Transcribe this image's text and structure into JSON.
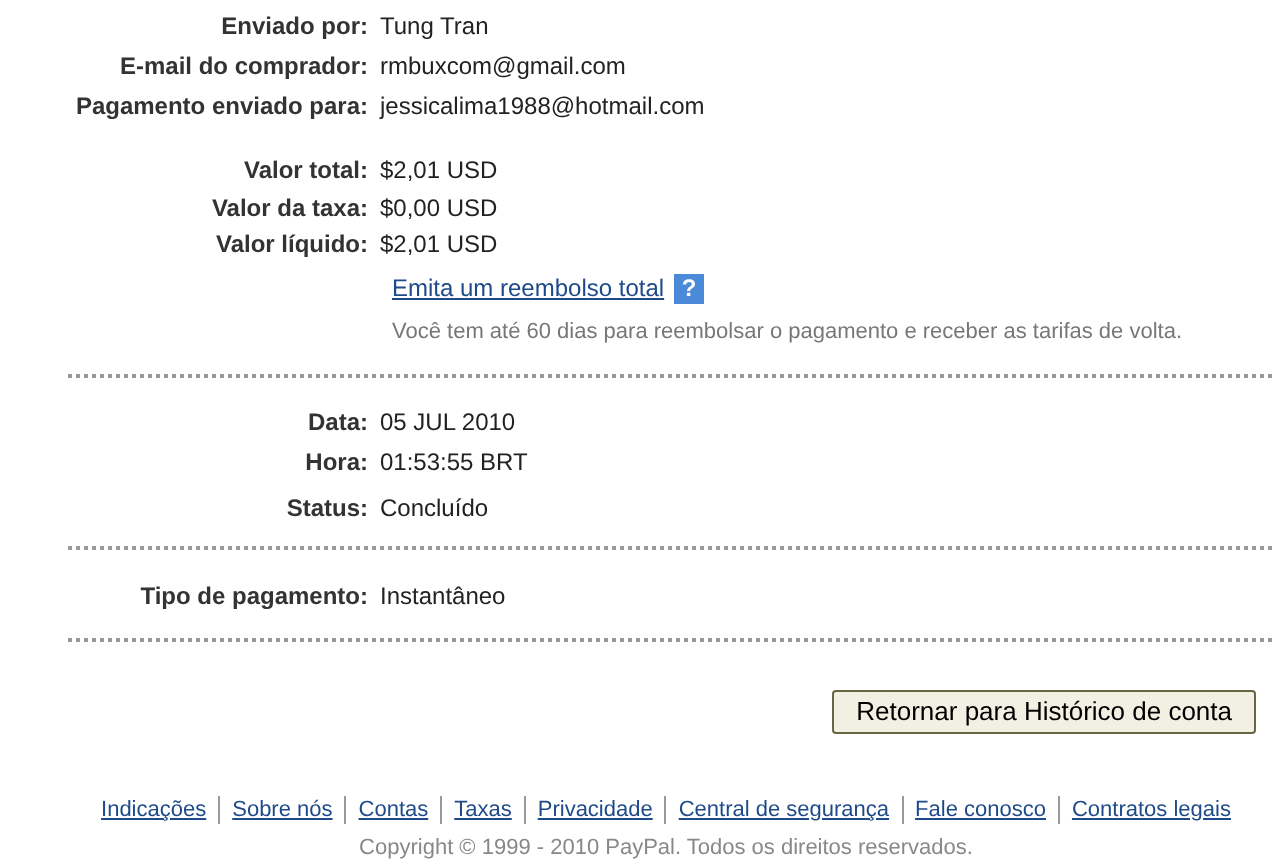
{
  "sender_rows": [
    {
      "label": "Enviado por:",
      "value": "Tung Tran"
    },
    {
      "label": "E-mail do comprador:",
      "value": "rmbuxcom@gmail.com"
    },
    {
      "label": "Pagamento enviado para:",
      "value": "jessicalima1988@hotmail.com"
    }
  ],
  "amount_rows": [
    {
      "label": "Valor total:",
      "value": "$2,01 USD"
    },
    {
      "label": "Valor da taxa:",
      "value": "$0,00 USD"
    },
    {
      "label": "Valor líquido:",
      "value": "$2,01 USD"
    }
  ],
  "refund_link": "Emita um reembolso total",
  "help_icon": "?",
  "refund_note": "Você tem até 60 dias para reembolsar o pagamento e receber as tarifas de volta.",
  "date_rows": [
    {
      "label": "Data:",
      "value": "05 JUL 2010"
    },
    {
      "label": "Hora:",
      "value": "01:53:55 BRT"
    },
    {
      "label": "Status:",
      "value": "Concluído"
    }
  ],
  "payment_rows": [
    {
      "label": "Tipo de pagamento:",
      "value": "Instantâneo"
    }
  ],
  "return_button": "Retornar para Histórico de conta",
  "footer_links": [
    "Indicações",
    "Sobre nós",
    "Contas",
    "Taxas",
    "Privacidade",
    "Central de segurança",
    "Fale conosco",
    "Contratos legais"
  ],
  "copyright": "Copyright © 1999 - 2010 PayPal. Todos os direitos reservados."
}
